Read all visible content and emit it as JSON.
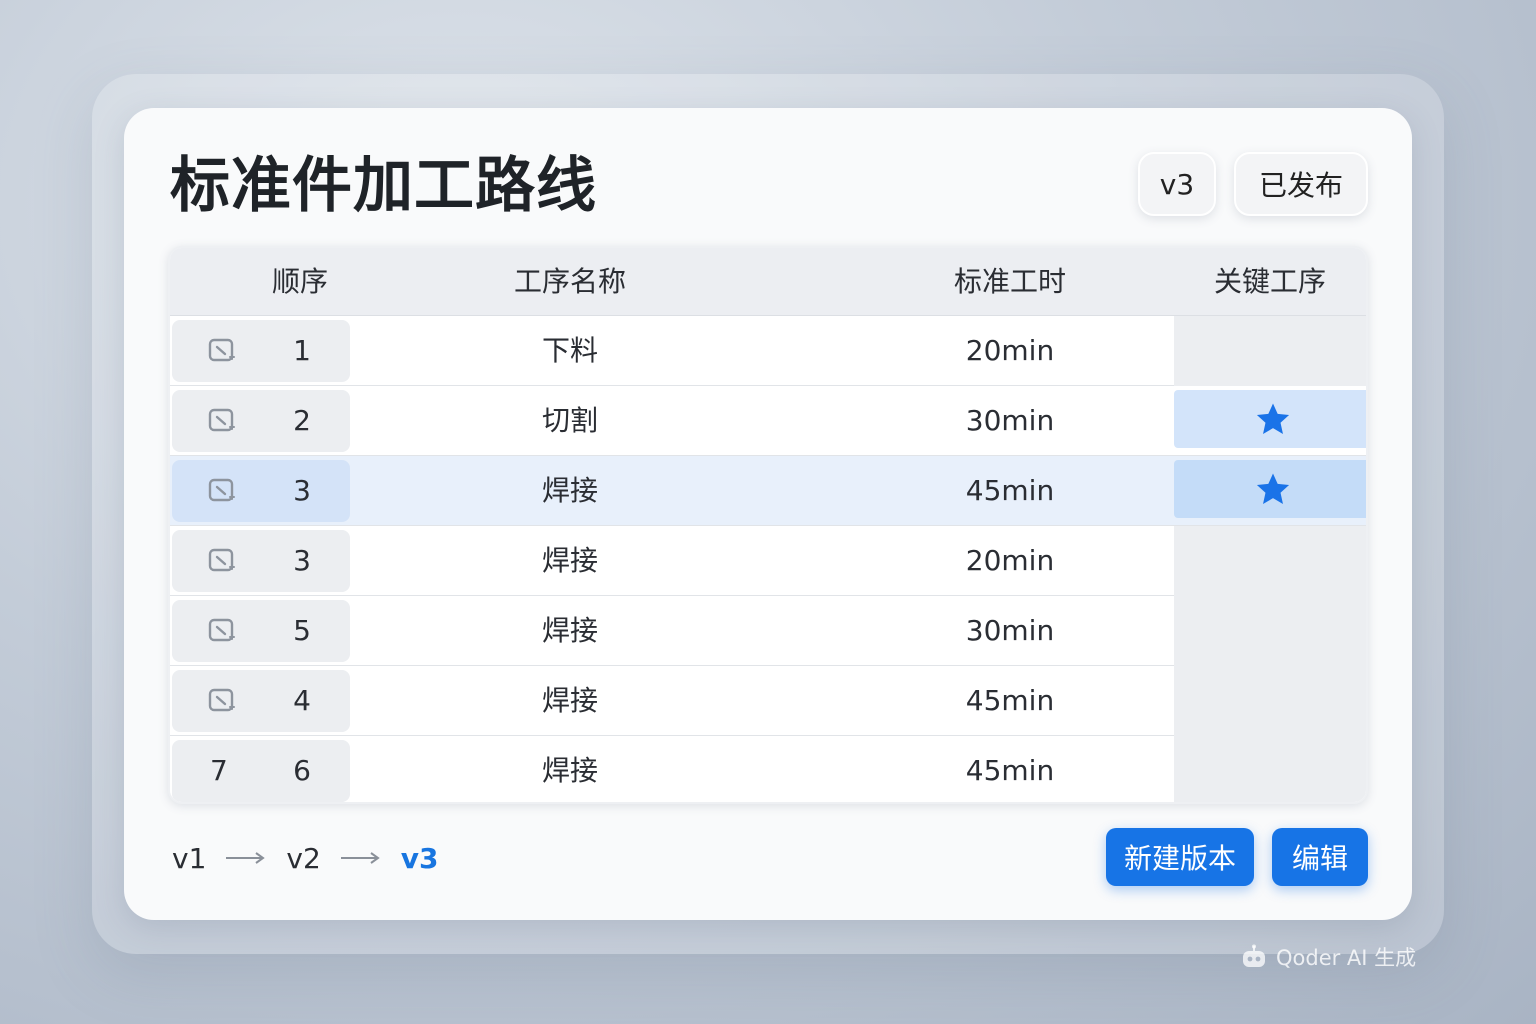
{
  "page": {
    "title": "标准件加工路线",
    "version_badge": "v3",
    "status_badge": "已发布"
  },
  "table": {
    "headers": [
      "顺序",
      "工序名称",
      "标准工时",
      "关键工序"
    ],
    "rows": [
      {
        "icon": "edit-icon",
        "icon_text": "",
        "seq": "1",
        "name": "下料",
        "time": "20min",
        "key": false,
        "highlighted": false
      },
      {
        "icon": "edit-icon",
        "icon_text": "",
        "seq": "2",
        "name": "切割",
        "time": "30min",
        "key": true,
        "highlighted": false
      },
      {
        "icon": "edit-icon",
        "icon_text": "",
        "seq": "3",
        "name": "焊接",
        "time": "45min",
        "key": true,
        "highlighted": true
      },
      {
        "icon": "edit-icon",
        "icon_text": "",
        "seq": "3",
        "name": "焊接",
        "time": "20min",
        "key": false,
        "highlighted": false
      },
      {
        "icon": "edit-icon",
        "icon_text": "",
        "seq": "5",
        "name": "焊接",
        "time": "30min",
        "key": false,
        "highlighted": false
      },
      {
        "icon": "edit-icon",
        "icon_text": "",
        "seq": "4",
        "name": "焊接",
        "time": "45min",
        "key": false,
        "highlighted": false
      },
      {
        "icon": "",
        "icon_text": "7",
        "seq": "6",
        "name": "焊接",
        "time": "45min",
        "key": false,
        "highlighted": false
      }
    ]
  },
  "versions": {
    "items": [
      "v1",
      "v2",
      "v3"
    ],
    "current": "v3"
  },
  "actions": {
    "new_version_label": "新建版本",
    "edit_label": "编辑"
  },
  "watermark": {
    "text": "Qoder AI 生成"
  },
  "colors": {
    "accent": "#1774e6",
    "highlight_row": "#e8f0fb",
    "star": "#1a73e8"
  }
}
